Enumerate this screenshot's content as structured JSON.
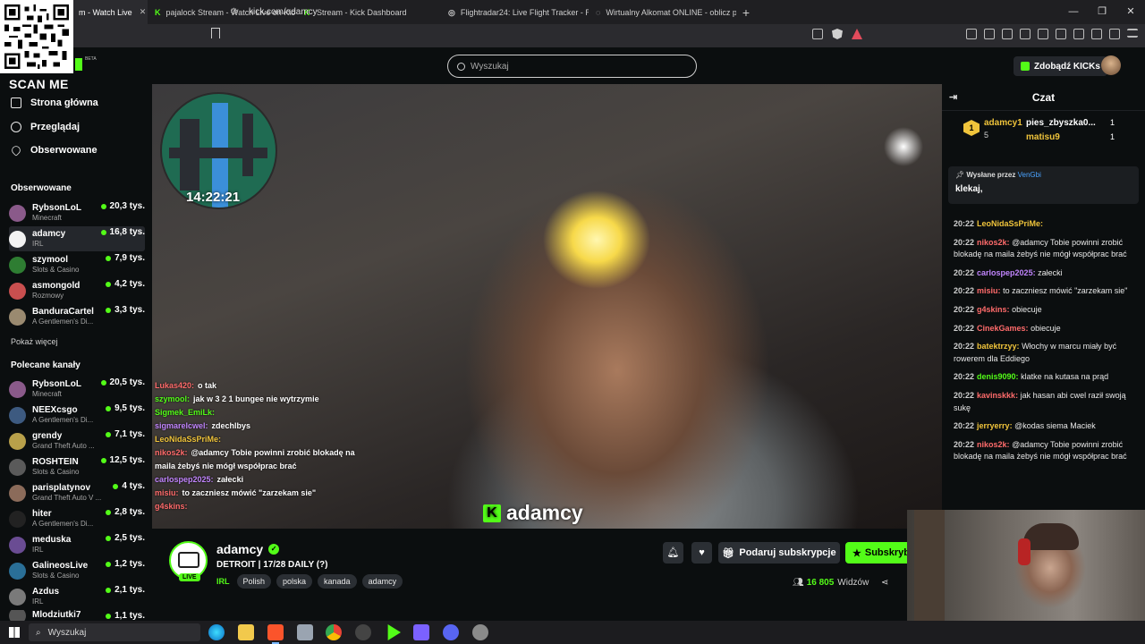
{
  "browser": {
    "tabs": [
      {
        "title": "m - Watch Live",
        "active": true,
        "favicon": "kick-icon"
      },
      {
        "title": "pajalock Stream - Watch Live on Kick",
        "active": false,
        "favicon": "kick-icon"
      },
      {
        "title": "Stream - Kick Dashboard",
        "active": false,
        "favicon": "kick-icon"
      },
      {
        "title": "Flightradar24: Live Flight Tracker - Re",
        "active": false,
        "favicon": "globe-icon"
      },
      {
        "title": "Wirtualny Alkomat ONLINE - oblicz p",
        "active": false,
        "favicon": "globe-icon"
      }
    ],
    "url": "kick.com/adamcy"
  },
  "overlay": {
    "scan_label": "SCAN ME"
  },
  "header": {
    "search_placeholder": "Wyszukaj",
    "kicks_button": "Zdobądź KICKs",
    "beta": "BETA"
  },
  "sidebar": {
    "nav": [
      {
        "label": "Strona główna",
        "icon": "home-icon"
      },
      {
        "label": "Przeglądaj",
        "icon": "compass-icon"
      },
      {
        "label": "Obserwowane",
        "icon": "heart-icon"
      }
    ],
    "following_title": "Obserwowane",
    "following": [
      {
        "name": "RybsonLoL",
        "category": "Minecraft",
        "viewers": "20,3 tys."
      },
      {
        "name": "adamcy",
        "category": "IRL",
        "viewers": "16,8 tys."
      },
      {
        "name": "szymool",
        "category": "Slots & Casino",
        "viewers": "7,9 tys."
      },
      {
        "name": "asmongold",
        "category": "Rozmowy",
        "viewers": "4,2 tys."
      },
      {
        "name": "BanduraCartel",
        "category": "A Gentlemen's Di...",
        "viewers": "3,3 tys."
      }
    ],
    "show_more": "Pokaż więcej",
    "recommended_title": "Polecane kanały",
    "recommended": [
      {
        "name": "RybsonLoL",
        "category": "Minecraft",
        "viewers": "20,5 tys."
      },
      {
        "name": "NEEXcsgo",
        "category": "A Gentlemen's Di...",
        "viewers": "9,5 tys."
      },
      {
        "name": "grendy",
        "category": "Grand Theft Auto ...",
        "viewers": "7,1 tys."
      },
      {
        "name": "ROSHTEIN",
        "category": "Slots & Casino",
        "viewers": "12,5 tys."
      },
      {
        "name": "parisplatynov",
        "category": "Grand Theft Auto V ...",
        "viewers": "4 tys."
      },
      {
        "name": "hiter",
        "category": "A Gentlemen's Di...",
        "viewers": "2,8 tys."
      },
      {
        "name": "meduska",
        "category": "IRL",
        "viewers": "2,5 tys."
      },
      {
        "name": "GalineosLive",
        "category": "Slots & Casino",
        "viewers": "1,2 tys."
      },
      {
        "name": "Azdus",
        "category": "IRL",
        "viewers": "2,1 tys."
      },
      {
        "name": "Mlodziutki7",
        "category": "",
        "viewers": "1,1 tys."
      }
    ]
  },
  "video": {
    "clock": "14:22:21",
    "watermark": "adamcy",
    "overlay_chat": [
      {
        "user": "Lukas420:",
        "text": "o tak",
        "color": "#ff6b6b"
      },
      {
        "user": "szymool:",
        "text": "jak w 3 2 1 bungee nie wytrzymie",
        "color": "#53fc18"
      },
      {
        "user": "Sigmek_EmiLk:",
        "text": "",
        "color": "#53fc18"
      },
      {
        "user": "sigmarelcwel:",
        "text": "zdechlbys",
        "color": "#c084fc"
      },
      {
        "user": "LeoNidaSsPriMe:",
        "text": "",
        "color": "#f0c43b"
      },
      {
        "user": "nikos2k:",
        "text": "@adamcy Tobie powinni zrobić blokadę na maila żebyś nie mógł współprac brać",
        "color": "#ff6b6b"
      },
      {
        "user": "carlospep2025:",
        "text": "załecki",
        "color": "#c084fc"
      },
      {
        "user": "misiu:",
        "text": "to zaczniesz mówić \"zarzekam sie\"",
        "color": "#ff6b6b"
      },
      {
        "user": "g4skins:",
        "text": "",
        "color": "#ff6b6b"
      }
    ]
  },
  "stream": {
    "channel": "adamcy",
    "live_label": "LIVE",
    "title": "DETROIT | 17/28 DAILY (?)",
    "category": "IRL",
    "tags": [
      "Polish",
      "polska",
      "kanada",
      "adamcy"
    ],
    "gift_label": "Podaruj subskrypcje",
    "subscribe_label": "Subskrybuj",
    "viewers_count": "16 805",
    "viewers_label": "Widzów"
  },
  "chat": {
    "title": "Czat",
    "leaderboard": {
      "first": {
        "rank": "1",
        "name": "adamcy1",
        "count": "5"
      },
      "second": {
        "name": "pies_zbyszka0...",
        "count": "1"
      },
      "third": {
        "name": "matisu9",
        "count": "1"
      }
    },
    "pinned": {
      "by_label": "Wysłane przez",
      "by_user": "VenGbi",
      "text": "klekaj,"
    },
    "messages": [
      {
        "time": "20:22",
        "user": "LeoNidaSsPriMe:",
        "text": "",
        "color": "#f0c43b"
      },
      {
        "time": "20:22",
        "user": "nikos2k:",
        "text": "@adamcy Tobie powinni zrobić blokadę na maila żebyś nie mógł współprac brać",
        "color": "#ff6b6b"
      },
      {
        "time": "20:22",
        "user": "carlospep2025:",
        "text": "załecki",
        "color": "#c084fc"
      },
      {
        "time": "20:22",
        "user": "misiu:",
        "text": "to zaczniesz mówić \"zarzekam sie\"",
        "color": "#ff6b6b"
      },
      {
        "time": "20:22",
        "user": "g4skins:",
        "text": "obiecuje",
        "color": "#ff6b6b"
      },
      {
        "time": "20:22",
        "user": "CinekGames:",
        "text": "obiecuje",
        "color": "#ff6b6b"
      },
      {
        "time": "20:22",
        "user": "batektrzyy:",
        "text": "Włochy w marcu miały być rowerem dla Eddiego",
        "color": "#f0c43b"
      },
      {
        "time": "20:22",
        "user": "denis9090:",
        "text": "klatke na kutasa na prąd",
        "color": "#53fc18"
      },
      {
        "time": "20:22",
        "user": "kavinskkk:",
        "text": "jak hasan abi cwel raził swoją sukę",
        "color": "#ff6b6b"
      },
      {
        "time": "20:22",
        "user": "jerryerry:",
        "text": "@kodas siema Maciek",
        "color": "#f0c43b"
      },
      {
        "time": "20:22",
        "user": "nikos2k:",
        "text": "@adamcy Tobie powinni zrobić blokadę na maila żebyś nie mógł współprac brać",
        "color": "#ff6b6b"
      }
    ]
  },
  "taskbar": {
    "search_placeholder": "Wyszukaj"
  },
  "colors": {
    "accent": "#53fc18",
    "background": "#0b0e0f",
    "panel": "#24272c"
  }
}
